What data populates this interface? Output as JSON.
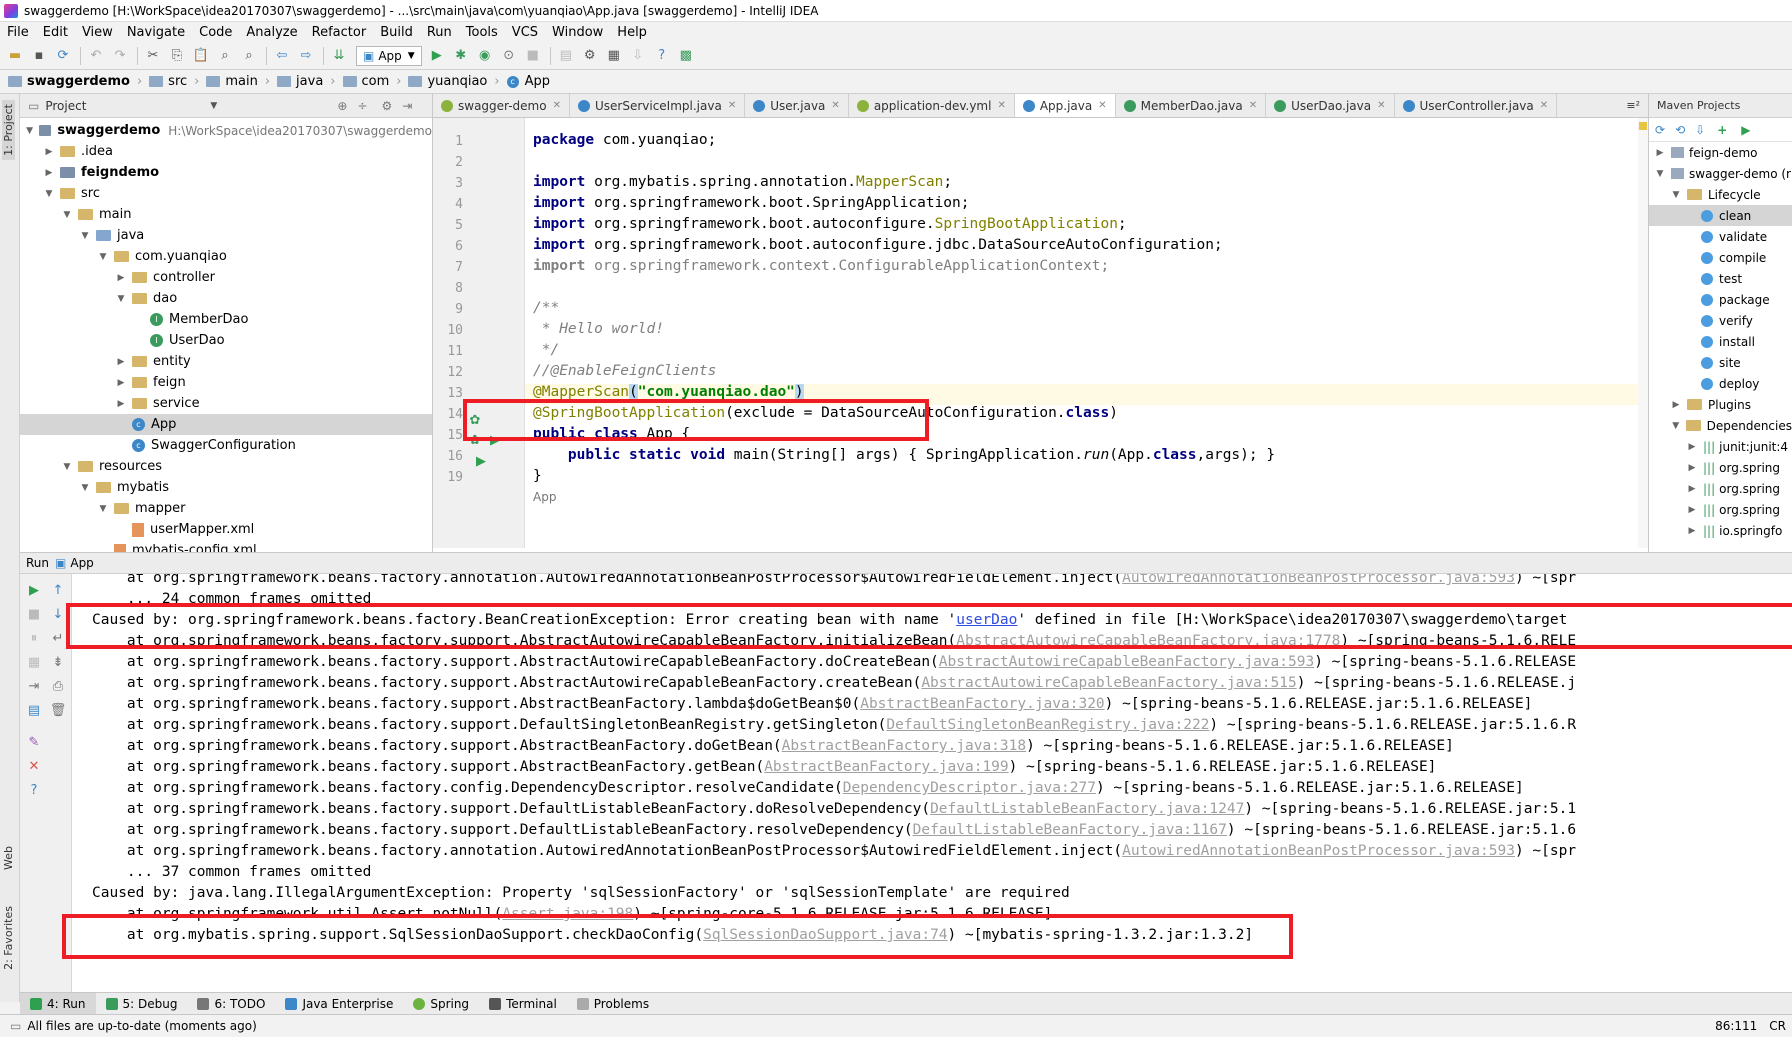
{
  "window": {
    "title": "swaggerdemo [H:\\WorkSpace\\idea20170307\\swaggerdemo] - ...\\src\\main\\java\\com\\yuanqiao\\App.java [swaggerdemo] - IntelliJ IDEA"
  },
  "menu": [
    "File",
    "Edit",
    "View",
    "Navigate",
    "Code",
    "Analyze",
    "Refactor",
    "Build",
    "Run",
    "Tools",
    "VCS",
    "Window",
    "Help"
  ],
  "toolbar": {
    "run_config": "App"
  },
  "breadcrumbs": [
    "swaggerdemo",
    "src",
    "main",
    "java",
    "com",
    "yuanqiao",
    "App"
  ],
  "left_strip": {
    "project_tab": "1: Project",
    "web_tab": "Web",
    "favorites_tab": "2: Favorites"
  },
  "project_panel": {
    "header": "Project",
    "root": "swaggerdemo",
    "root_path": "H:\\WorkSpace\\idea20170307\\swaggerdemo",
    "items": [
      ".idea",
      "feigndemo",
      "src",
      "main",
      "java",
      "com.yuanqiao",
      "controller",
      "dao",
      "MemberDao",
      "UserDao",
      "entity",
      "feign",
      "service",
      "App",
      "SwaggerConfiguration",
      "resources",
      "mybatis",
      "mapper",
      "userMapper.xml",
      "mybatis-config.xml"
    ]
  },
  "editor_tabs": [
    "swagger-demo",
    "UserServiceImpl.java",
    "User.java",
    "application-dev.yml",
    "App.java",
    "MemberDao.java",
    "UserDao.java",
    "UserController.java"
  ],
  "tab_menu": "≡²",
  "code": {
    "line_numbers": [
      "1",
      "2",
      "3",
      "4",
      "5",
      "6",
      "7",
      "8",
      "9",
      "10",
      "11",
      "12",
      "13",
      "14",
      "15",
      "16",
      "19"
    ],
    "l1_kw": "package",
    "l1_rest": " com.yuanqiao;",
    "import_kw": "import",
    "l3_rest": " org.mybatis.spring.annotation.",
    "l3_ann": "MapperScan",
    "semi": ";",
    "l4_rest": " org.springframework.boot.SpringApplication;",
    "l5_rest": " org.springframework.boot.autoconfigure.",
    "l5_ann": "SpringBootApplication",
    "l6_rest": " org.springframework.boot.autoconfigure.jdbc.DataSourceAutoConfiguration;",
    "l7_rest": " org.springframework.context.ConfigurableApplicationContext;",
    "l9": "/**",
    "l10": " * Hello world!",
    "l11": " */",
    "l12": "//@EnableFeignClients",
    "l13_ann": "@MapperScan",
    "l13_open": "(",
    "l13_str": "\"com.yuanqiao.dao\"",
    "l13_close": ")",
    "l14_ann": "@SpringBootApplication",
    "l14_mid": "(exclude = DataSourceAutoConfiguration.",
    "l14_kw": "class",
    "l14_end": ")",
    "l15_kw": "public class",
    "l15_rest": " App {",
    "l16_kw1": "public static void",
    "l16_rest": " main(String[] args) { SpringApplication.",
    "l16_run": "run",
    "l16_app": "(App.",
    "l16_kw2": "class",
    "l16_end": ",args); }",
    "l19": "}",
    "hint": "App"
  },
  "maven": {
    "header": "Maven Projects",
    "items": [
      "feign-demo",
      "swagger-demo (r",
      "Lifecycle",
      "clean",
      "validate",
      "compile",
      "test",
      "package",
      "verify",
      "install",
      "site",
      "deploy",
      "Plugins",
      "Dependencies",
      "junit:junit:4",
      "org.spring",
      "org.spring",
      "org.spring",
      "io.springfo"
    ]
  },
  "run_panel": {
    "label": "Run",
    "config": "App",
    "lines": [
      {
        "pre": "    at org.springframework.beans.factory.annotation.AutowiredAnnotationBeanPostProcessor$AutowiredFieldElement.inject(",
        "link": "AutowiredAnnotationBeanPostProcessor.java:593",
        "post": ") ~[spr"
      },
      {
        "pre": "    ... 24 common frames omitted",
        "link": "",
        "post": ""
      },
      {
        "pre": "Caused by: org.springframework.beans.factory.BeanCreationException: Error creating bean with name '",
        "link": "userDao",
        "post": "' defined in file [H:\\WorkSpace\\idea20170307\\swaggerdemo\\target"
      },
      {
        "pre": "    at org.springframework.beans.factory.support.AbstractAutowireCapableBeanFactory.initializeBean(",
        "link": "AbstractAutowireCapableBeanFactory.java:1778",
        "post": ") ~[spring-beans-5.1.6.RELE"
      },
      {
        "pre": "    at org.springframework.beans.factory.support.AbstractAutowireCapableBeanFactory.doCreateBean(",
        "link": "AbstractAutowireCapableBeanFactory.java:593",
        "post": ") ~[spring-beans-5.1.6.RELEASE"
      },
      {
        "pre": "    at org.springframework.beans.factory.support.AbstractAutowireCapableBeanFactory.createBean(",
        "link": "AbstractAutowireCapableBeanFactory.java:515",
        "post": ") ~[spring-beans-5.1.6.RELEASE.j"
      },
      {
        "pre": "    at org.springframework.beans.factory.support.AbstractBeanFactory.lambda$doGetBean$0(",
        "link": "AbstractBeanFactory.java:320",
        "post": ") ~[spring-beans-5.1.6.RELEASE.jar:5.1.6.RELEASE]"
      },
      {
        "pre": "    at org.springframework.beans.factory.support.DefaultSingletonBeanRegistry.getSingleton(",
        "link": "DefaultSingletonBeanRegistry.java:222",
        "post": ") ~[spring-beans-5.1.6.RELEASE.jar:5.1.6.R"
      },
      {
        "pre": "    at org.springframework.beans.factory.support.AbstractBeanFactory.doGetBean(",
        "link": "AbstractBeanFactory.java:318",
        "post": ") ~[spring-beans-5.1.6.RELEASE.jar:5.1.6.RELEASE]"
      },
      {
        "pre": "    at org.springframework.beans.factory.support.AbstractBeanFactory.getBean(",
        "link": "AbstractBeanFactory.java:199",
        "post": ") ~[spring-beans-5.1.6.RELEASE.jar:5.1.6.RELEASE]"
      },
      {
        "pre": "    at org.springframework.beans.factory.config.DependencyDescriptor.resolveCandidate(",
        "link": "DependencyDescriptor.java:277",
        "post": ") ~[spring-beans-5.1.6.RELEASE.jar:5.1.6.RELEASE]"
      },
      {
        "pre": "    at org.springframework.beans.factory.support.DefaultListableBeanFactory.doResolveDependency(",
        "link": "DefaultListableBeanFactory.java:1247",
        "post": ") ~[spring-beans-5.1.6.RELEASE.jar:5.1"
      },
      {
        "pre": "    at org.springframework.beans.factory.support.DefaultListableBeanFactory.resolveDependency(",
        "link": "DefaultListableBeanFactory.java:1167",
        "post": ") ~[spring-beans-5.1.6.RELEASE.jar:5.1.6"
      },
      {
        "pre": "    at org.springframework.beans.factory.annotation.AutowiredAnnotationBeanPostProcessor$AutowiredFieldElement.inject(",
        "link": "AutowiredAnnotationBeanPostProcessor.java:593",
        "post": ") ~[spr"
      },
      {
        "pre": "    ... 37 common frames omitted",
        "link": "",
        "post": ""
      },
      {
        "pre": "Caused by: java.lang.IllegalArgumentException: Property 'sqlSessionFactory' or 'sqlSessionTemplate' are required",
        "link": "",
        "post": ""
      },
      {
        "pre": "    at org.springframework.util.Assert.notNull(",
        "link": "Assert.java:198",
        "post": ") ~[spring-core-5.1.6.RELEASE.jar:5.1.6.RELEASE]"
      },
      {
        "pre": "    at org.mybatis.spring.support.SqlSessionDaoSupport.checkDaoConfig(",
        "link": "SqlSessionDaoSupport.java:74",
        "post": ") ~[mybatis-spring-1.3.2.jar:1.3.2]"
      }
    ]
  },
  "bottom_tabs": [
    "4: Run",
    "5: Debug",
    "6: TODO",
    "Java Enterprise",
    "Spring",
    "Terminal",
    "Problems"
  ],
  "status": {
    "message": "All files are up-to-date (moments ago)",
    "position": "86:111",
    "line_sep": "CR"
  },
  "colors": {
    "highlight_box": "#ee1c25",
    "keyword": "#000080",
    "annotation": "#808000",
    "string": "#008000"
  }
}
